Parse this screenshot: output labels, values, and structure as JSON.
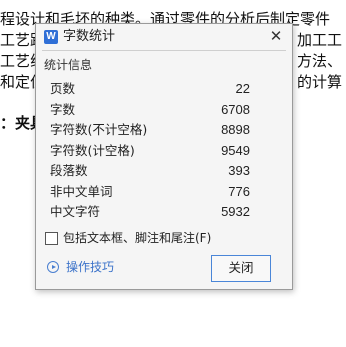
{
  "document": {
    "lines": [
      "程设计和毛坯的种类。通过零件的分析后制定零件",
      "工艺路",
      "工艺线",
      "和定位",
      "：夹具"
    ],
    "right_fragments": [
      "加工工",
      "方法、",
      "的计算"
    ]
  },
  "dialog": {
    "title": "字数统计",
    "app_icon": "W",
    "close_glyph": "✕",
    "section_label": "统计信息",
    "stats": [
      {
        "label": "页数",
        "value": "22"
      },
      {
        "label": "字数",
        "value": "6708"
      },
      {
        "label": "字符数(不计空格)",
        "value": "8898"
      },
      {
        "label": "字符数(计空格)",
        "value": "9549"
      },
      {
        "label": "段落数",
        "value": "393"
      },
      {
        "label": "非中文单词",
        "value": "776"
      },
      {
        "label": "中文字符",
        "value": "5932"
      }
    ],
    "checkbox_label": "包括文本框、脚注和尾注(F)",
    "checkbox_checked": false,
    "tips_label": "操作技巧",
    "close_button_label": "关闭"
  }
}
